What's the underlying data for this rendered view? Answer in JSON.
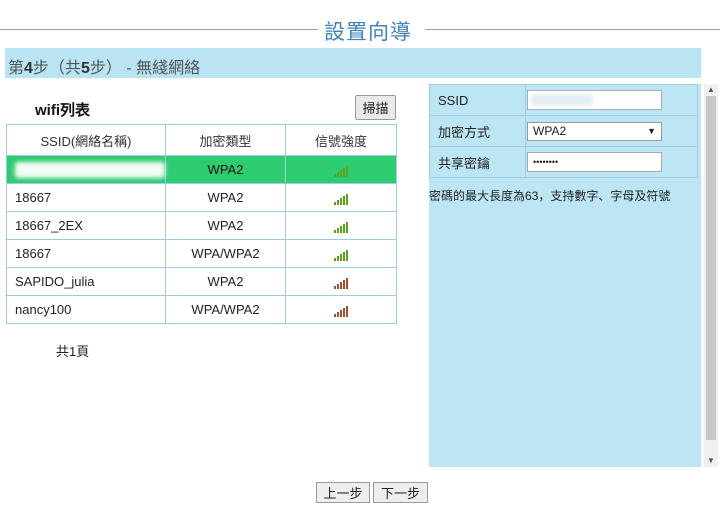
{
  "header": {
    "title": "設置向導"
  },
  "step": {
    "prefix": "第",
    "current": "4",
    "middle": "步（共",
    "total": "5",
    "suffix": "步） - 無綫網絡"
  },
  "wifi_list": {
    "title": "wifi列表",
    "scan_label": "掃描",
    "columns": [
      "SSID(網絡名稱)",
      "加密類型",
      "信號強度"
    ],
    "rows": [
      {
        "ssid": "",
        "encryption": "WPA2",
        "signal_icon": "signal-strong-green-icon",
        "selected": true
      },
      {
        "ssid": "18667",
        "encryption": "WPA2",
        "signal_icon": "signal-strong-green-icon"
      },
      {
        "ssid": "18667_2EX",
        "encryption": "WPA2",
        "signal_icon": "signal-strong-green-icon"
      },
      {
        "ssid": "18667",
        "encryption": "WPA/WPA2",
        "signal_icon": "signal-strong-green-icon"
      },
      {
        "ssid": "SAPIDO_julia",
        "encryption": "WPA2",
        "signal_icon": "signal-strong-brown-icon"
      },
      {
        "ssid": "nancy100",
        "encryption": "WPA/WPA2",
        "signal_icon": "signal-strong-brown-icon"
      }
    ],
    "page_count": "共1頁"
  },
  "form": {
    "ssid_label": "SSID",
    "ssid_value": "",
    "security_label": "加密方式",
    "security_value": "WPA2",
    "password_label": "共享密鑰",
    "password_value": "••••••••",
    "hint": "密碼的最大長度為63，支持數字、字母及符號"
  },
  "footer": {
    "prev_label": "上一步",
    "next_label": "下一步"
  },
  "colors": {
    "selected_row": "#2ecc71",
    "panel_bg": "#bde6f4",
    "title": "#3f84b8"
  }
}
